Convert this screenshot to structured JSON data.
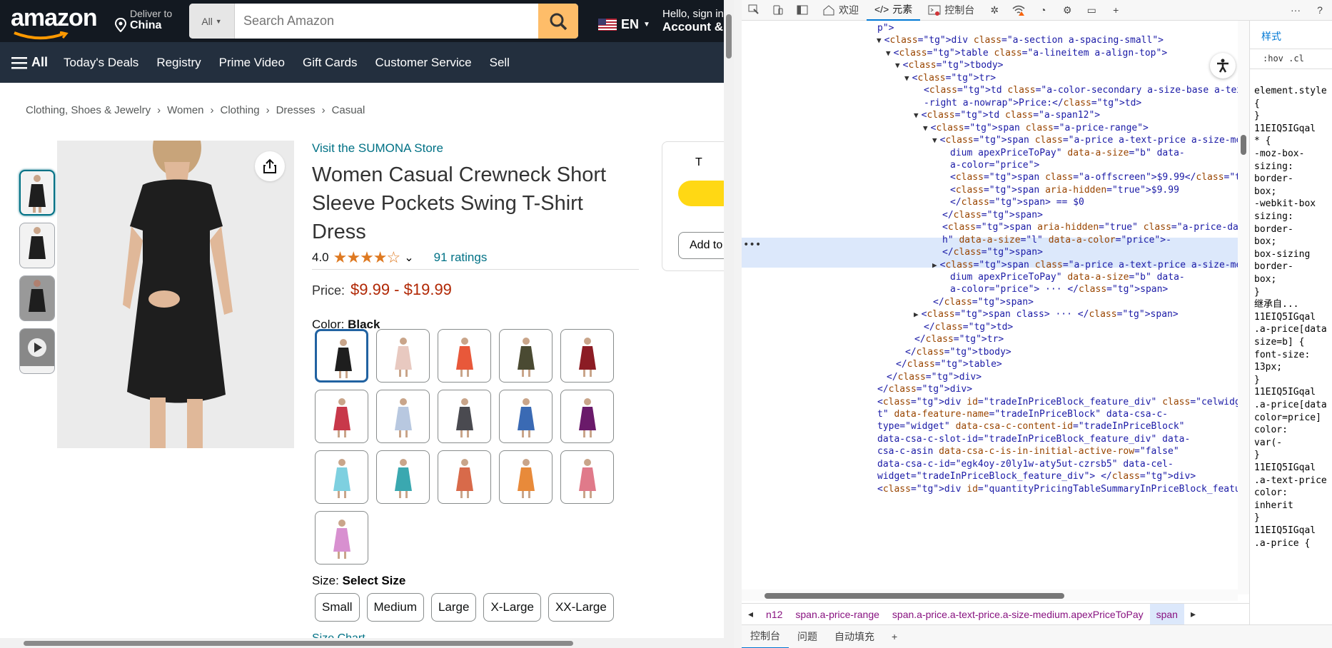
{
  "amazon": {
    "logo": "amazon",
    "deliver_line1": "Deliver to",
    "deliver_line2": "China",
    "search_category": "All",
    "search_placeholder": "Search Amazon",
    "lang": "EN",
    "account_line1": "Hello, sign in",
    "account_line2": "Account & Lists",
    "nav_all": "All",
    "nav_items": [
      "Today's Deals",
      "Registry",
      "Prime Video",
      "Gift Cards",
      "Customer Service",
      "Sell"
    ],
    "breadcrumb": [
      "Clothing, Shoes & Jewelry",
      "Women",
      "Clothing",
      "Dresses",
      "Casual"
    ],
    "breadcrumb_sep": "›",
    "store_link": "Visit the SUMONA Store",
    "title": "Women Casual Crewneck Short Sleeve Pockets Swing T-Shirt Dress",
    "rating": "4.0",
    "stars": "★★★★☆",
    "ratings_count": "91 ratings",
    "price_label": "Price:",
    "price_value": "$9.99 - $19.99",
    "color_label": "Color:",
    "color_value": "Black",
    "swatch_colors": [
      "#1e1e1e",
      "#e8c9c0",
      "#e8583a",
      "#4a4a32",
      "#8c1c24",
      "#c8384a",
      "#b8c8e0",
      "#4a4a50",
      "#3a6ab4",
      "#6a1a6a",
      "#7ed0e0",
      "#3aa8b0",
      "#d86a4a",
      "#e88a3a",
      "#e07a8a",
      "#d890d0"
    ],
    "size_label": "Size:",
    "size_value": "Select Size",
    "sizes": [
      "Small",
      "Medium",
      "Large",
      "X-Large",
      "XX-Large"
    ],
    "size_chart": "Size Chart",
    "buybox_text": "T",
    "buybox_add": "Add to"
  },
  "devtools": {
    "tabs": [
      "欢迎",
      "元素",
      "控制台"
    ],
    "active_tab": "元素",
    "bottom_tabs": [
      "控制台",
      "问题",
      "自动填充"
    ],
    "breadcrumb": [
      "n12",
      "span.a-price-range",
      "span.a-price.a-text-price.a-size-medium.apexPriceToPay",
      "span"
    ],
    "styles_tab": "样式",
    "styles_filter": ":hov .cl",
    "styles_lines": [
      "element.style",
      "{",
      "}",
      "11EIQ5IGqal",
      "* {",
      "-moz-box-",
      "sizing:",
      "border-",
      "box;",
      "-webkit-box",
      "sizing:",
      "border-",
      "box;",
      "box-sizing",
      "border-",
      "box;",
      "}",
      "继承自...",
      "11EIQ5IGqal",
      ".a-price[data",
      "size=b] {",
      "font-size:",
      "13px;",
      "}",
      "11EIQ5IGqal",
      ".a-price[data",
      "color=price]",
      "color:",
      "var(-",
      "}",
      "11EIQ5IGqal",
      ".a-text-price",
      "color:",
      "inherit",
      "}",
      "11EIQ5IGqal",
      ".a-price {"
    ],
    "code_lines": [
      {
        "i": 0,
        "t": "p\">"
      },
      {
        "i": 1,
        "tri": "▼",
        "t": "<div class=\"a-section a-spacing-small\">"
      },
      {
        "i": 2,
        "tri": "▼",
        "t": "<table class=\"a-lineitem a-align-top\">"
      },
      {
        "i": 3,
        "tri": "▼",
        "t": "<tbody>"
      },
      {
        "i": 4,
        "tri": "▼",
        "t": "<tr>"
      },
      {
        "i": 5,
        "t": "<td class=\"a-color-secondary a-size-base a-text"
      },
      {
        "i": 5,
        "t": "-right a-nowrap\">Price:</td>"
      },
      {
        "i": 5,
        "tri": "▼",
        "t": "<td class=\"a-span12\">"
      },
      {
        "i": 6,
        "tri": "▼",
        "t": "<span class=\"a-price-range\">"
      },
      {
        "i": 7,
        "tri": "▼",
        "t": "<span class=\"a-price a-text-price a-size-me"
      },
      {
        "i": 8,
        "t": "dium apexPriceToPay\" data-a-size=\"b\" data-"
      },
      {
        "i": 8,
        "t": "a-color=\"price\">"
      },
      {
        "i": 8,
        "t": "<span class=\"a-offscreen\">$9.99</span>"
      },
      {
        "i": 8,
        "t": "<span aria-hidden=\"true\">$9.99"
      },
      {
        "i": 8,
        "t": "</span> == $0"
      },
      {
        "i": 7,
        "t": "</span>"
      },
      {
        "i": 7,
        "t": "<span aria-hidden=\"true\" class=\"a-price-das"
      },
      {
        "i": 7,
        "t": "h\" data-a-size=\"l\" data-a-color=\"price\">-"
      },
      {
        "i": 7,
        "t": "</span>"
      },
      {
        "i": 7,
        "tri": "▶",
        "t": "<span class=\"a-price a-text-price a-size-me"
      },
      {
        "i": 8,
        "t": "dium apexPriceToPay\" data-a-size=\"b\" data-"
      },
      {
        "i": 8,
        "t": "a-color=\"price\"> ··· </span>"
      },
      {
        "i": 6,
        "t": "</span>"
      },
      {
        "i": 5,
        "tri": "▶",
        "t": "<span class> ··· </span>"
      },
      {
        "i": 5,
        "t": "</td>"
      },
      {
        "i": 4,
        "t": "</tr>"
      },
      {
        "i": 3,
        "t": "</tbody>"
      },
      {
        "i": 2,
        "t": "</table>"
      },
      {
        "i": 1,
        "t": "</div>"
      },
      {
        "i": 0,
        "t": "</div>"
      },
      {
        "i": 0,
        "t": "<div id=\"tradeInPriceBlock_feature_div\" class=\"celwidge"
      },
      {
        "i": 0,
        "t": "t\" data-feature-name=\"tradeInPriceBlock\" data-csa-c-"
      },
      {
        "i": 0,
        "t": "type=\"widget\" data-csa-c-content-id=\"tradeInPriceBlock\""
      },
      {
        "i": 0,
        "t": "data-csa-c-slot-id=\"tradeInPriceBlock_feature_div\" data-"
      },
      {
        "i": 0,
        "t": "csa-c-asin data-csa-c-is-in-initial-active-row=\"false\""
      },
      {
        "i": 0,
        "t": "data-csa-c-id=\"egk4oy-z0ly1w-aty5ut-czrsb5\" data-cel-"
      },
      {
        "i": 0,
        "t": "widget=\"tradeInPriceBlock_feature_div\"> </div>"
      },
      {
        "i": 0,
        "t": "<div id=\"quantityPricingTableSummaryInPriceBlock_feature"
      }
    ]
  }
}
